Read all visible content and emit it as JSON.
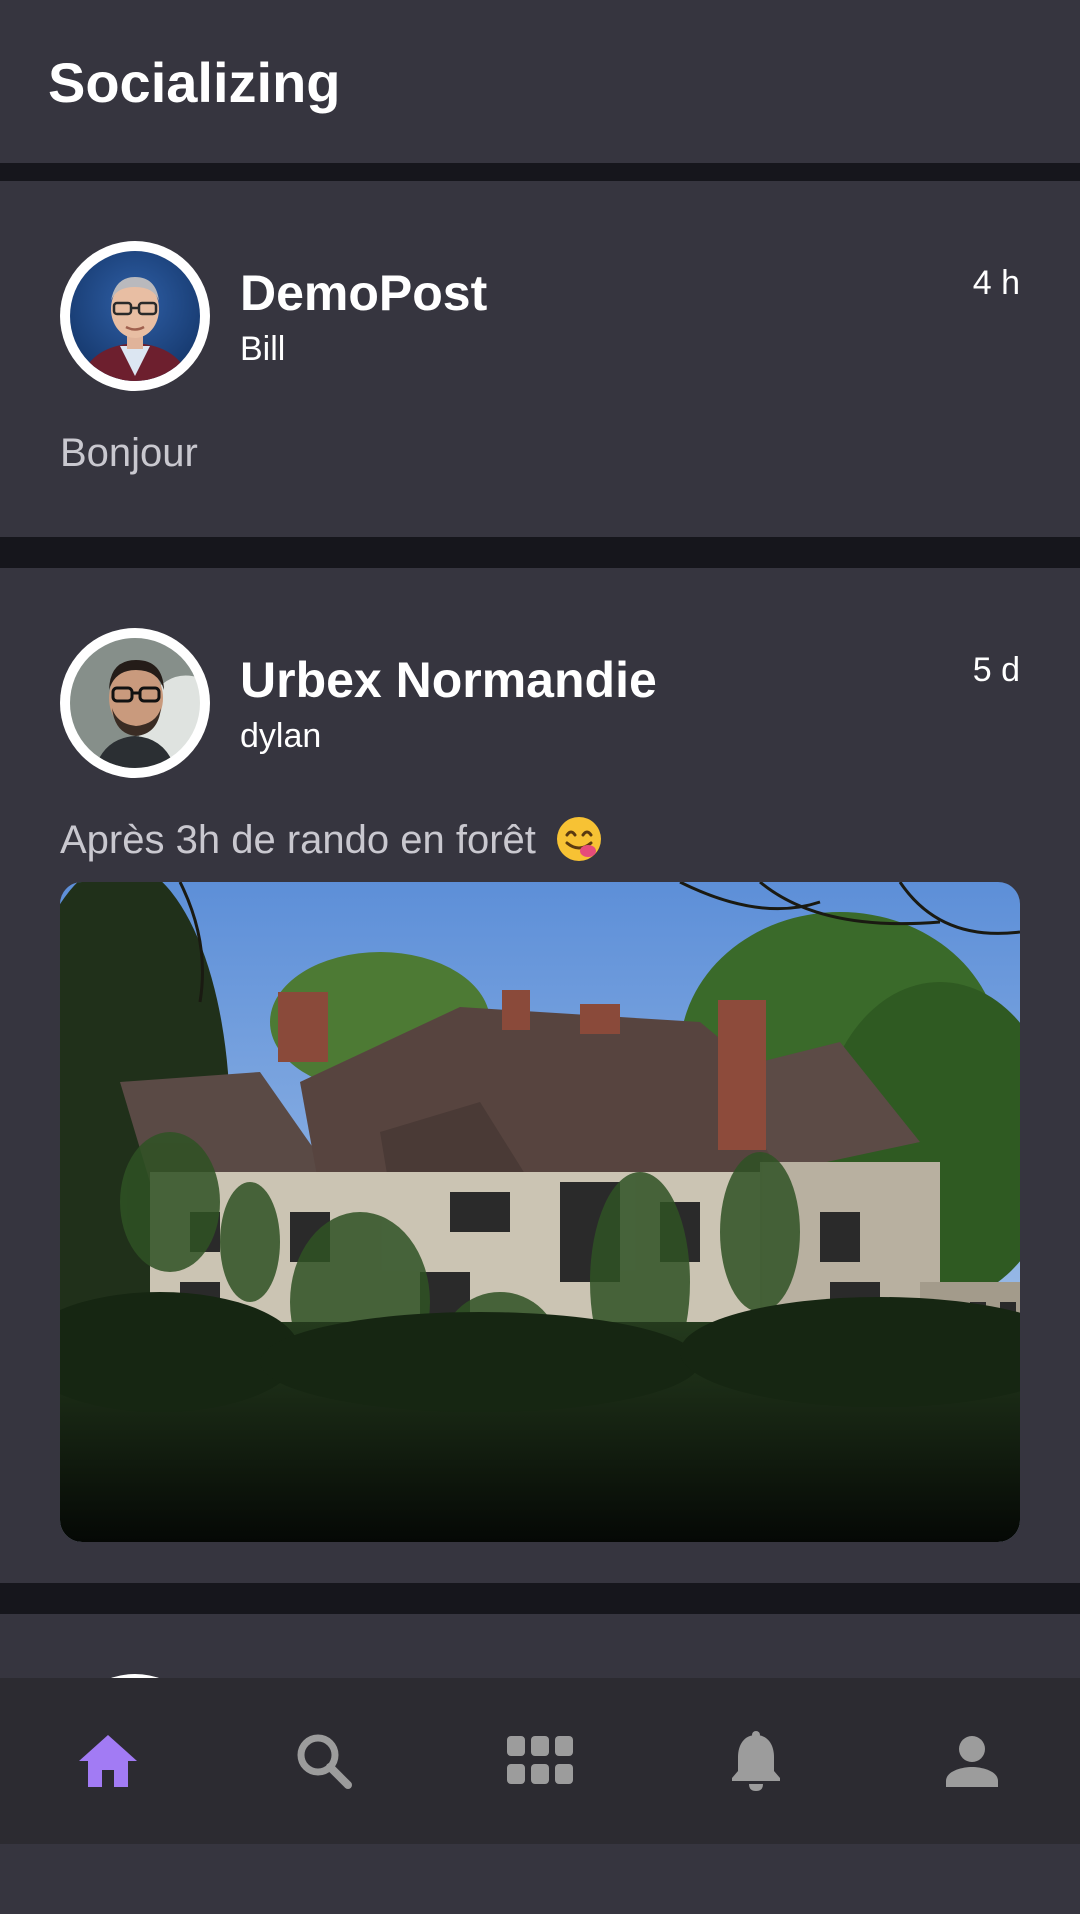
{
  "app": {
    "title": "Socializing"
  },
  "theme": {
    "background": "#16161c",
    "card": "#36353f",
    "accent": "#a27bf4",
    "nav_icon": "#9c9c9c",
    "muted_text": "#c9c8cf"
  },
  "posts": [
    {
      "group": "DemoPost",
      "author": "Bill",
      "time": "4 h",
      "text": "Bonjour",
      "avatar_icon": "person-glasses-avatar"
    },
    {
      "group": "Urbex Normandie",
      "author": "dylan",
      "time": "5 d",
      "text": "Après 3h de rando en forêt",
      "emoji": "face-savoring-food-emoji",
      "avatar_icon": "person-glasses-beard-avatar",
      "image": "abandoned-manor-photo"
    }
  ],
  "bottom_nav": [
    {
      "name": "home",
      "icon": "home-icon",
      "active": true
    },
    {
      "name": "search",
      "icon": "search-icon",
      "active": false
    },
    {
      "name": "groups",
      "icon": "grid-icon",
      "active": false
    },
    {
      "name": "notifications",
      "icon": "bell-icon",
      "active": false
    },
    {
      "name": "profile",
      "icon": "person-icon",
      "active": false
    }
  ]
}
